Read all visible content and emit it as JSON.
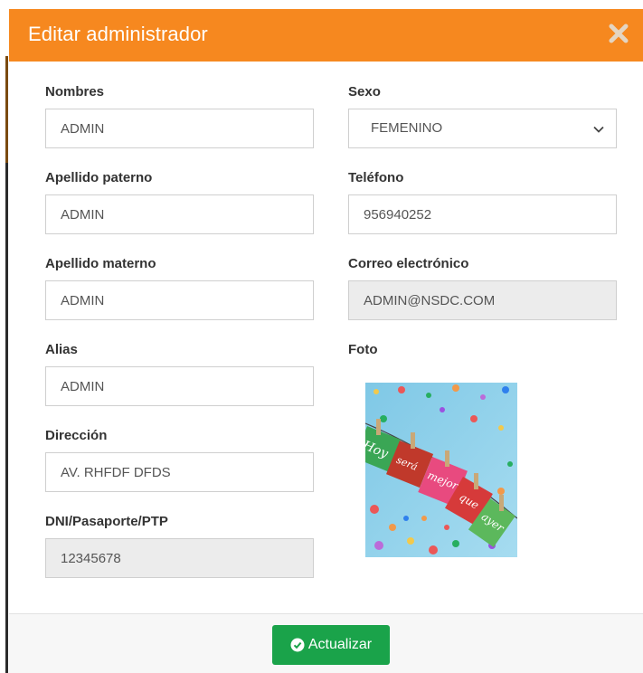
{
  "modal": {
    "title": "Editar administrador"
  },
  "form": {
    "nombres": {
      "label": "Nombres",
      "value": "ADMIN"
    },
    "sexo": {
      "label": "Sexo",
      "selected": "FEMENINO"
    },
    "apellido_paterno": {
      "label": "Apellido paterno",
      "value": "ADMIN"
    },
    "telefono": {
      "label": "Teléfono",
      "value": "956940252"
    },
    "apellido_materno": {
      "label": "Apellido materno",
      "value": "ADMIN"
    },
    "correo": {
      "label": "Correo electrónico",
      "value": "ADMIN@NSDC.COM"
    },
    "alias": {
      "label": "Alias",
      "value": "ADMIN"
    },
    "foto": {
      "label": "Foto",
      "image_text": [
        "Hoy",
        "será",
        "mejor",
        "que",
        "ayer"
      ]
    },
    "direccion": {
      "label": "Dirección",
      "value": "AV. RHFDF DFDS"
    },
    "dni": {
      "label": "DNI/Pasaporte/PTP",
      "value": "12345678"
    }
  },
  "footer": {
    "update_label": "Actualizar"
  },
  "colors": {
    "header": "#f6881f",
    "button": "#1aa34a",
    "readonly_bg": "#ececec"
  },
  "icons": {
    "close": "close-icon",
    "chevron": "chevron-down-icon",
    "check": "check-circle-icon"
  }
}
